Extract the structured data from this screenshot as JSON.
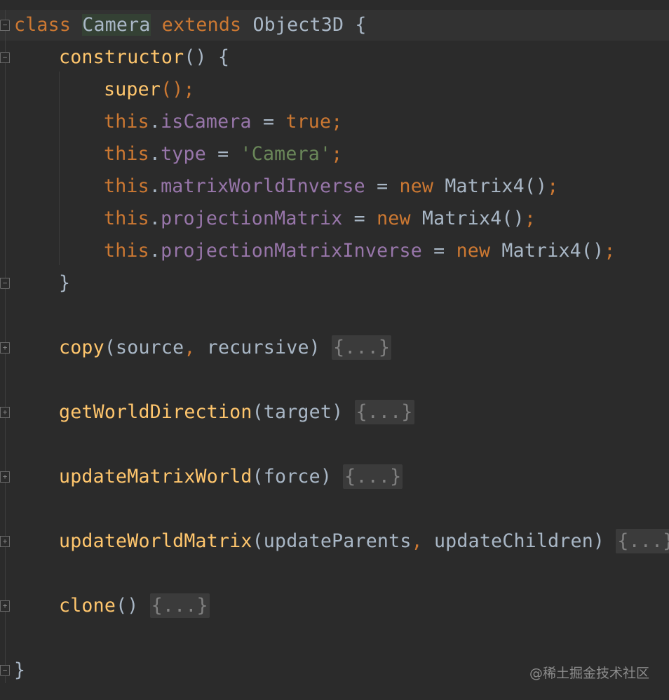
{
  "code": {
    "line1": {
      "kw1": "class",
      "name": "Camera",
      "kw2": "extends",
      "base": "Object3D",
      "brace": "{"
    },
    "line2": {
      "fn": "constructor",
      "rest": "() {"
    },
    "line3": {
      "fn": "super",
      "rest": "();"
    },
    "line4": {
      "this": "this",
      "dot": ".",
      "prop": "isCamera",
      "eq": " = ",
      "val": "true",
      "semi": ";"
    },
    "line5": {
      "this": "this",
      "dot": ".",
      "prop": "type",
      "eq": " = ",
      "str": "'Camera'",
      "semi": ";"
    },
    "line6": {
      "this": "this",
      "dot": ".",
      "prop": "matrixWorldInverse",
      "eq": " = ",
      "kw": "new",
      "cls": " Matrix4()",
      "semi": ";"
    },
    "line7": {
      "this": "this",
      "dot": ".",
      "prop": "projectionMatrix",
      "eq": " = ",
      "kw": "new",
      "cls": " Matrix4()",
      "semi": ";"
    },
    "line8": {
      "this": "this",
      "dot": ".",
      "prop": "projectionMatrixInverse",
      "eq": " = ",
      "kw": "new",
      "cls": " Matrix4()",
      "semi": ";"
    },
    "line9": {
      "text": "}"
    },
    "copy": {
      "fn": "copy",
      "p1": "(source",
      "comma": ",",
      "p2": " recursive) ",
      "folded": "{...}"
    },
    "getWorldDirection": {
      "fn": "getWorldDirection",
      "params": "(target) ",
      "folded": "{...}"
    },
    "updateMatrixWorld": {
      "fn": "updateMatrixWorld",
      "params": "(force) ",
      "folded": "{...}"
    },
    "updateWorldMatrix": {
      "fn": "updateWorldMatrix",
      "p1": "(updateParents",
      "comma": ",",
      "p2": " updateChildren) ",
      "folded": "{...}"
    },
    "clone": {
      "fn": "clone",
      "params": "() ",
      "folded": "{...}"
    },
    "closing": {
      "text": "}"
    }
  },
  "watermark": "@稀土掘金技术社区",
  "colors": {
    "background": "#2b2b2b",
    "keyword": "#cc7832",
    "function": "#ffc66d",
    "property": "#9876aa",
    "string": "#6a8759",
    "default": "#a9b7c6",
    "folded": "#808080"
  }
}
